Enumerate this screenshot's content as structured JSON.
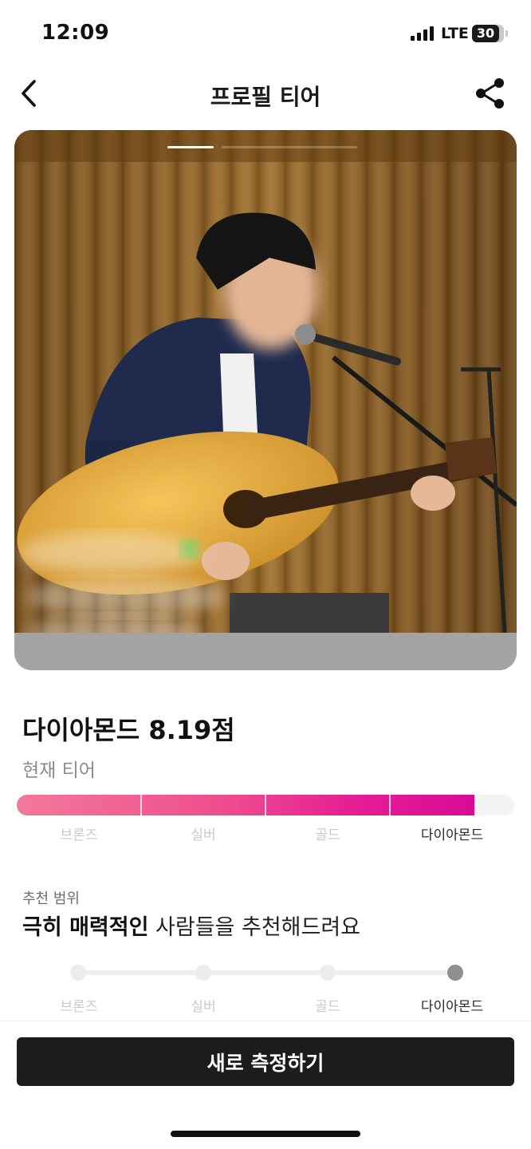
{
  "status_bar": {
    "time": "12:09",
    "network": "LTE",
    "battery_level": "30"
  },
  "header": {
    "title": "프로필 티어",
    "back_icon": "chevron-left-icon",
    "share_icon": "share-icon"
  },
  "photo": {
    "pages_total": 2,
    "active_page": 1
  },
  "tier": {
    "score_text": "다이아몬드 8.19점",
    "caption": "현재 티어",
    "progress_fraction": 0.92,
    "levels": [
      "브론즈",
      "실버",
      "골드",
      "다이아몬드"
    ],
    "active_level_index": 3
  },
  "recommendation": {
    "caption": "추천 범위",
    "highlight": "극히 매력적인",
    "rest": " 사람들을 추천해드려요",
    "levels": [
      "브론즈",
      "실버",
      "골드",
      "다이아몬드"
    ],
    "active_level_index": 3
  },
  "cta": {
    "label": "새로 측정하기"
  },
  "colors": {
    "accent_start": "#f2799a",
    "accent_end": "#d80c95",
    "cta_bg": "#1c1c1c"
  }
}
